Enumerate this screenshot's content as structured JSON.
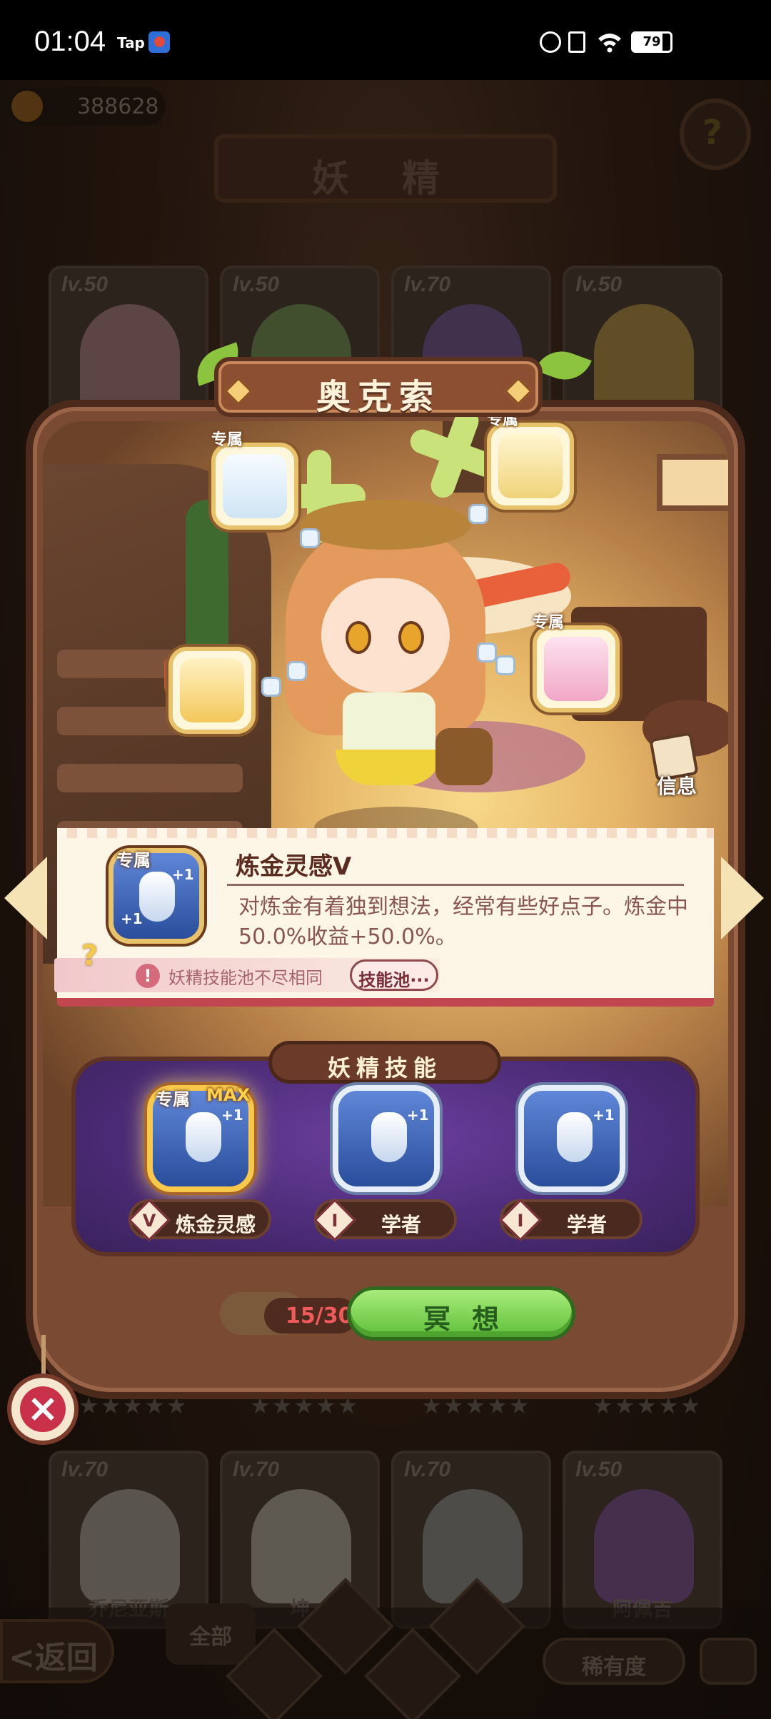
{
  "status_bar": {
    "time": "01:04",
    "app_tag": "Tap",
    "battery": "79"
  },
  "top": {
    "currency": "388628",
    "title": "妖 精"
  },
  "background_cards_top": [
    {
      "level": "lv.50",
      "color": "#e8a9b0"
    },
    {
      "level": "lv.50",
      "color": "#8ec66b"
    },
    {
      "level": "lv.70",
      "color": "#8f6ac8"
    },
    {
      "level": "lv.50",
      "color": "#f2c44e"
    }
  ],
  "background_cards_bottom": [
    {
      "level": "lv.70",
      "name": "乔尼亚斯",
      "color": "#d9d9c8"
    },
    {
      "level": "lv.70",
      "name": "坤",
      "color": "#e9e9d9"
    },
    {
      "level": "lv.70",
      "name": "",
      "color": "#b8c0b8"
    },
    {
      "level": "lv.50",
      "name": "阿佩吉",
      "color": "#9a63c8"
    }
  ],
  "bottom_nav": {
    "back_label": "<返回",
    "filter_all": "全部",
    "rarity_label": "稀有度"
  },
  "fairy": {
    "name": "奥克索",
    "info_label": "信息",
    "exclusive_tag": "专属"
  },
  "skill_detail": {
    "tag": "专属",
    "title": "炼金灵感V",
    "description": "对炼金有着独到想法，经常有些好点子。炼金中50.0%收益+50.0%。",
    "pool_note": "妖精技能池不尽相同",
    "pool_button": "技能池···"
  },
  "skills": {
    "header": "妖精技能",
    "items": [
      {
        "tag": "专属",
        "badge": "MAX",
        "level": "V",
        "label": "炼金灵感",
        "selected": true
      },
      {
        "tag": "",
        "badge": "",
        "level": "I",
        "label": "学者",
        "selected": false
      },
      {
        "tag": "",
        "badge": "",
        "level": "I",
        "label": "学者",
        "selected": false
      }
    ],
    "plus_one": "+1"
  },
  "meditate": {
    "energy": "15/30",
    "button": "冥想"
  }
}
